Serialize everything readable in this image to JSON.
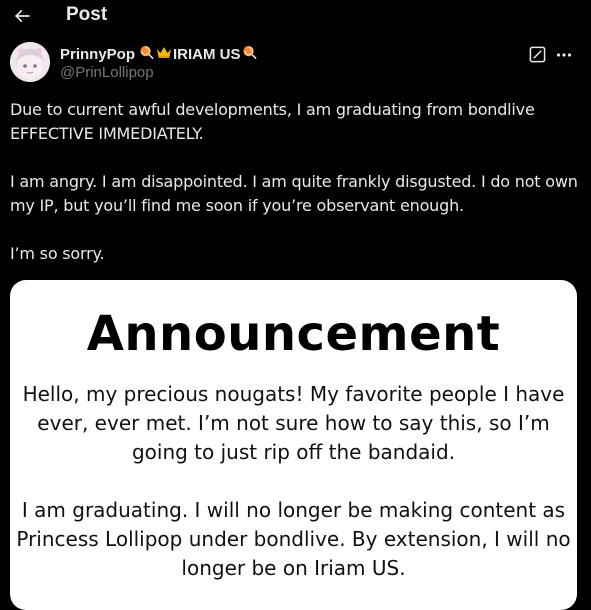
{
  "header": {
    "title": "Post",
    "back_icon": "arrow-left-icon"
  },
  "author": {
    "display_name": "PrinnyPop",
    "handle": "@PrinLollipop",
    "name_emojis": [
      "lollipop",
      "crown",
      "lollipop"
    ],
    "name_text": "IRIAM US"
  },
  "post": {
    "paragraphs": [
      "Due to current awful developments, I am graduating from bondlive EFFECTIVE IMMEDIATELY.",
      "I am angry. I am disappointed. I am quite frankly disgusted. I do not own my IP, but you’ll find me soon if you’re observant enough.",
      "I’m so sorry."
    ]
  },
  "media": {
    "title": "Announcement",
    "paragraphs": [
      "Hello, my precious nougats! My favorite people I have ever, ever met. I’m not sure how to say this, so I’m going to just rip off the bandaid.",
      "I am graduating. I will no longer be making content as Princess Lollipop under bondlive. By extension, I will no longer be on Iriam US."
    ]
  },
  "colors": {
    "background": "#000000",
    "text_primary": "#e7e9ea",
    "text_secondary": "#71767b",
    "card_background": "#ffffff"
  }
}
